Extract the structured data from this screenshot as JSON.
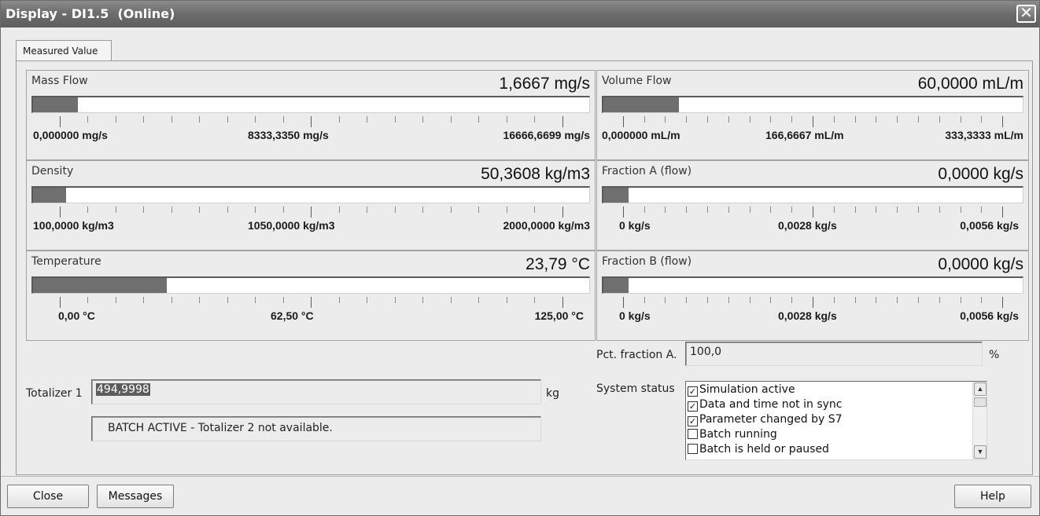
{
  "window": {
    "title": "Display - DI1.5  (Online)",
    "close_glyph": "✕"
  },
  "tabs": [
    {
      "label": "Measured Value",
      "active": true
    }
  ],
  "meters": [
    {
      "label": "Mass Flow",
      "value": "1,6667 mg/s",
      "fill_fraction": 0.08,
      "scale": [
        "0,000000 mg/s",
        "8333,3350 mg/s",
        "16666,6699 mg/s"
      ]
    },
    {
      "label": "Volume Flow",
      "value": "60,0000 mL/m",
      "fill_fraction": 0.18,
      "scale": [
        "0,000000 mL/m",
        "166,6667 mL/m",
        "333,3333 mL/m"
      ]
    },
    {
      "label": "Density",
      "value": "50,3608 kg/m3",
      "fill_fraction": 0.06,
      "scale": [
        "100,0000 kg/m3",
        "1050,0000 kg/m3",
        "2000,0000 kg/m3"
      ]
    },
    {
      "label": "Fraction A (flow)",
      "value": "0,0000 kg/s",
      "fill_fraction": 0.06,
      "scale": [
        "0 kg/s",
        "0,0028 kg/s",
        "0,0056 kg/s"
      ]
    },
    {
      "label": "Temperature",
      "value": "23,79 °C",
      "fill_fraction": 0.24,
      "scale": [
        "0,00 °C",
        "62,50 °C",
        "125,00 °C"
      ]
    },
    {
      "label": "Fraction B (flow)",
      "value": "0,0000 kg/s",
      "fill_fraction": 0.06,
      "scale": [
        "0 kg/s",
        "0,0028 kg/s",
        "0,0056 kg/s"
      ]
    }
  ],
  "totalizer": {
    "label": "Totalizer 1",
    "value": "494,9998",
    "unit": "kg",
    "message": "BATCH ACTIVE - Totalizer 2 not available."
  },
  "pct_fraction": {
    "label": "Pct. fraction A.",
    "value": "100,0",
    "unit": "%"
  },
  "system_status": {
    "label": "System status",
    "items": [
      {
        "label": "Simulation active",
        "checked": true
      },
      {
        "label": "Data and time not in sync",
        "checked": true
      },
      {
        "label": "Parameter changed by S7",
        "checked": true
      },
      {
        "label": "Batch running",
        "checked": false
      },
      {
        "label": "Batch is held or paused",
        "checked": false
      }
    ]
  },
  "buttons": {
    "close": "Close",
    "messages": "Messages",
    "help": "Help"
  },
  "colors": {
    "bar_fill": "#6f6f6f",
    "title_bar": "#6d6d6d",
    "selection": "#5c5c5c"
  }
}
